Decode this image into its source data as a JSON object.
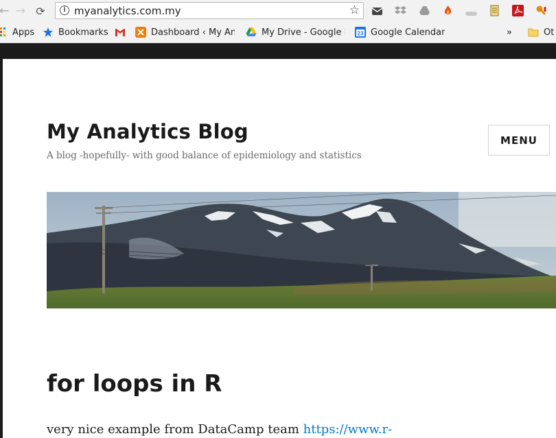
{
  "browser": {
    "url": "myanalytics.com.my",
    "bookmarks": [
      {
        "label": "Apps",
        "icon": "apps-grid-icon"
      },
      {
        "label": "Bookmarks",
        "icon": "star-icon"
      },
      {
        "label": "",
        "icon": "gmail-icon"
      },
      {
        "label": "Dashboard ‹ My Ana",
        "icon": "xampp-icon"
      },
      {
        "label": "My Drive - Google D",
        "icon": "google-drive-icon"
      },
      {
        "label": "Google Calendar",
        "icon": "google-calendar-icon"
      },
      {
        "label": "»",
        "icon": "overflow-chevron-icon"
      },
      {
        "label": "Ot",
        "icon": "folder-icon"
      }
    ],
    "calendar_day": "23",
    "extensions": [
      "mail-icon",
      "dropbox-icon",
      "drive-extension-icon",
      "flame-icon",
      "grey-extension-icon",
      "notes-icon",
      "acrobat-icon",
      "key-icon"
    ]
  },
  "blog": {
    "title": "My Analytics Blog",
    "tagline": "A blog -hopefully- with good balance of epidemiology and statistics",
    "menu_label": "MENU"
  },
  "post": {
    "title": "for loops in R",
    "body_text": "very nice example from DataCamp team ",
    "link_text": "https://www.r-"
  },
  "colors": {
    "link": "#007acc",
    "chrome_bg": "#f2f2f2",
    "page_frame": "#1b1b1b"
  }
}
